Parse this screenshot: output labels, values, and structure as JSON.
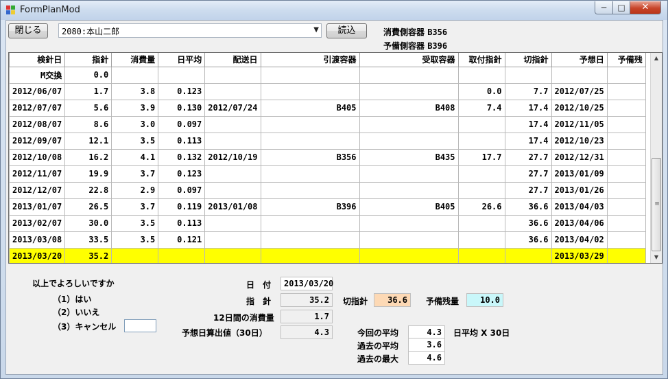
{
  "window": {
    "title": "FormPlanMod"
  },
  "toolbar": {
    "close_label": "閉じる",
    "combo_value": "2080:本山二郎",
    "load_label": "読込"
  },
  "info": {
    "consume_label": "消費側容器",
    "consume_value": "B356",
    "reserve_label": "予備側容器",
    "reserve_value": "B396"
  },
  "table": {
    "headers": [
      "検針日",
      "指針",
      "消費量",
      "日平均",
      "配送日",
      "引渡容器",
      "受取容器",
      "取付指針",
      "切指針",
      "予想日",
      "予備残"
    ],
    "rows": [
      [
        "M交換",
        "0.0",
        "",
        "",
        "",
        "",
        "",
        "",
        "",
        "",
        ""
      ],
      [
        "2012/06/07",
        "1.7",
        "3.8",
        "0.123",
        "",
        "",
        "",
        "0.0",
        "7.7",
        "2012/07/25",
        ""
      ],
      [
        "2012/07/07",
        "5.6",
        "3.9",
        "0.130",
        "2012/07/24",
        "B405",
        "B408",
        "7.4",
        "17.4",
        "2012/10/25",
        ""
      ],
      [
        "2012/08/07",
        "8.6",
        "3.0",
        "0.097",
        "",
        "",
        "",
        "",
        "17.4",
        "2012/11/05",
        ""
      ],
      [
        "2012/09/07",
        "12.1",
        "3.5",
        "0.113",
        "",
        "",
        "",
        "",
        "17.4",
        "2012/10/23",
        ""
      ],
      [
        "2012/10/08",
        "16.2",
        "4.1",
        "0.132",
        "2012/10/19",
        "B356",
        "B435",
        "17.7",
        "27.7",
        "2012/12/31",
        ""
      ],
      [
        "2012/11/07",
        "19.9",
        "3.7",
        "0.123",
        "",
        "",
        "",
        "",
        "27.7",
        "2013/01/09",
        ""
      ],
      [
        "2012/12/07",
        "22.8",
        "2.9",
        "0.097",
        "",
        "",
        "",
        "",
        "27.7",
        "2013/01/26",
        ""
      ],
      [
        "2013/01/07",
        "26.5",
        "3.7",
        "0.119",
        "2013/01/08",
        "B396",
        "B405",
        "26.6",
        "36.6",
        "2013/04/03",
        ""
      ],
      [
        "2013/02/07",
        "30.0",
        "3.5",
        "0.113",
        "",
        "",
        "",
        "",
        "36.6",
        "2013/04/06",
        ""
      ],
      [
        "2013/03/08",
        "33.5",
        "3.5",
        "0.121",
        "",
        "",
        "",
        "",
        "36.6",
        "2013/04/02",
        ""
      ],
      [
        "2013/03/20",
        "35.2",
        "",
        "",
        "",
        "",
        "",
        "",
        "",
        "2013/03/29",
        ""
      ]
    ],
    "highlight_row": 11,
    "highlight_color": "#ffff00"
  },
  "prompt": {
    "question": "以上でよろしいですか",
    "opt1": "（1）はい",
    "opt2": "（2）いいえ",
    "opt3": "（3）キャンセル",
    "input_value": ""
  },
  "summary": {
    "date_label": "日　付",
    "date_value": "2013/03/20",
    "needle_label": "指　針",
    "needle_value": "35.2",
    "cut_label": "切指針",
    "cut_value": "36.6",
    "reserve_remain_label": "予備残量",
    "reserve_remain_value": "10.0",
    "consume12_label": "12日間の消費量",
    "consume12_value": "1.7",
    "expect_calc_label": "予想日算出値（30日）",
    "expect_calc_value": "4.3",
    "avg_now_label": "今回の平均",
    "avg_now_value": "4.3",
    "avg_past_label": "過去の平均",
    "avg_past_value": "3.6",
    "max_past_label": "過去の最大",
    "max_past_value": "4.6",
    "formula_label": "日平均 X 30日"
  }
}
